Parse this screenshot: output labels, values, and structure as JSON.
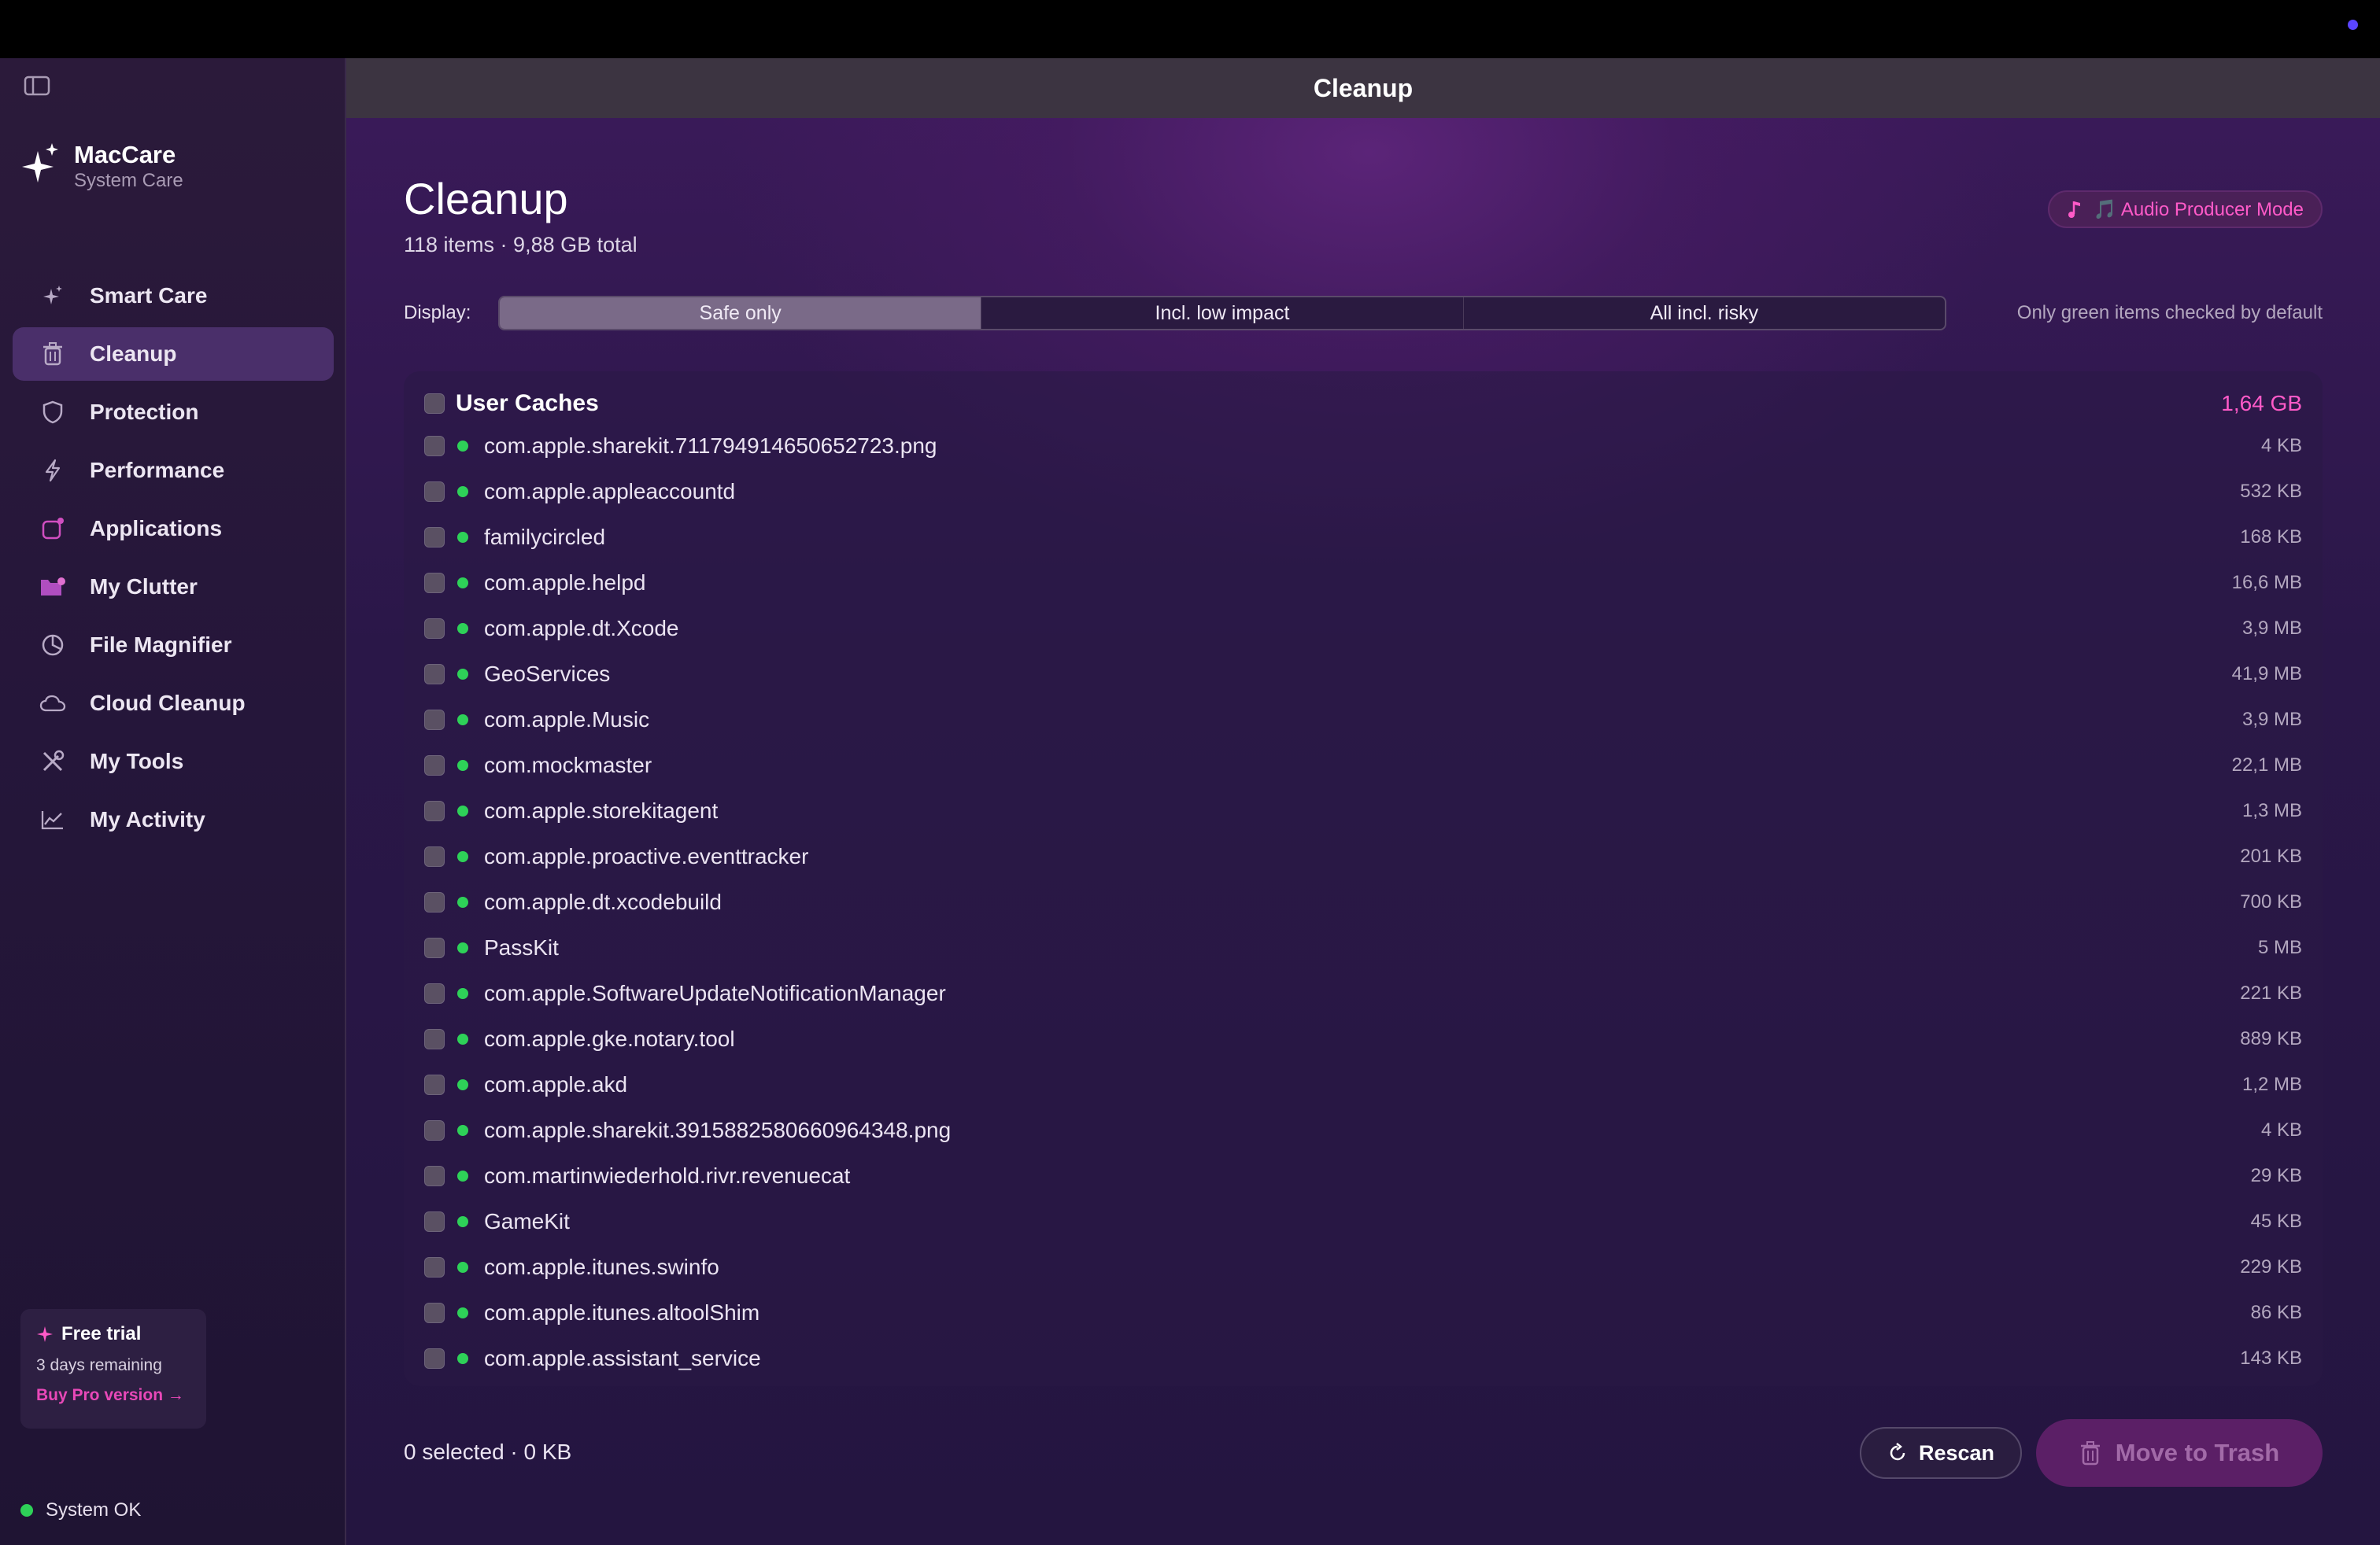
{
  "window": {
    "title": "Cleanup"
  },
  "sidebar": {
    "brand_name": "MacCare",
    "brand_sub": "System Care",
    "items": [
      {
        "label": "Smart Care",
        "icon": "sparkle-icon"
      },
      {
        "label": "Cleanup",
        "icon": "trash-icon",
        "active": true
      },
      {
        "label": "Protection",
        "icon": "shield-icon"
      },
      {
        "label": "Performance",
        "icon": "bolt-icon"
      },
      {
        "label": "Applications",
        "icon": "apps-icon"
      },
      {
        "label": "My Clutter",
        "icon": "folder-icon"
      },
      {
        "label": "File Magnifier",
        "icon": "pie-chart-icon"
      },
      {
        "label": "Cloud Cleanup",
        "icon": "cloud-icon"
      },
      {
        "label": "My Tools",
        "icon": "tools-icon"
      },
      {
        "label": "My Activity",
        "icon": "activity-chart-icon"
      }
    ],
    "trial": {
      "title": "Free trial",
      "sub": "3 days remaining",
      "link": "Buy Pro version →"
    },
    "status": "System OK"
  },
  "header": {
    "title": "Cleanup",
    "subtitle": "118 items · 9,88 GB total",
    "mode": "🎵 Audio Producer Mode"
  },
  "display": {
    "label": "Display:",
    "options": [
      "Safe only",
      "Incl. low impact",
      "All incl. risky"
    ],
    "selected": 0,
    "hint": "Only green items checked by default"
  },
  "group": {
    "title": "User Caches",
    "size": "1,64 GB",
    "items": [
      {
        "name": "com.apple.sharekit.711794914650652723.png",
        "size": "4 KB"
      },
      {
        "name": "com.apple.appleaccountd",
        "size": "532 KB"
      },
      {
        "name": "familycircled",
        "size": "168 KB"
      },
      {
        "name": "com.apple.helpd",
        "size": "16,6 MB"
      },
      {
        "name": "com.apple.dt.Xcode",
        "size": "3,9 MB"
      },
      {
        "name": "GeoServices",
        "size": "41,9 MB"
      },
      {
        "name": "com.apple.Music",
        "size": "3,9 MB"
      },
      {
        "name": "com.mockmaster",
        "size": "22,1 MB"
      },
      {
        "name": "com.apple.storekitagent",
        "size": "1,3 MB"
      },
      {
        "name": "com.apple.proactive.eventtracker",
        "size": "201 KB"
      },
      {
        "name": "com.apple.dt.xcodebuild",
        "size": "700 KB"
      },
      {
        "name": "PassKit",
        "size": "5 MB"
      },
      {
        "name": "com.apple.SoftwareUpdateNotificationManager",
        "size": "221 KB"
      },
      {
        "name": "com.apple.gke.notary.tool",
        "size": "889 KB"
      },
      {
        "name": "com.apple.akd",
        "size": "1,2 MB"
      },
      {
        "name": "com.apple.sharekit.3915882580660964348.png",
        "size": "4 KB"
      },
      {
        "name": "com.martinwiederhold.rivr.revenuecat",
        "size": "29 KB"
      },
      {
        "name": "GameKit",
        "size": "45 KB"
      },
      {
        "name": "com.apple.itunes.swinfo",
        "size": "229 KB"
      },
      {
        "name": "com.apple.itunes.altoolShim",
        "size": "86 KB"
      },
      {
        "name": "com.apple.assistant_service",
        "size": "143 KB"
      }
    ]
  },
  "footer": {
    "selected": "0 selected · 0 KB",
    "rescan": "Rescan",
    "trash": "Move to Trash"
  },
  "colors": {
    "accent": "#ff5ac8",
    "ok_green": "#2ed158"
  }
}
